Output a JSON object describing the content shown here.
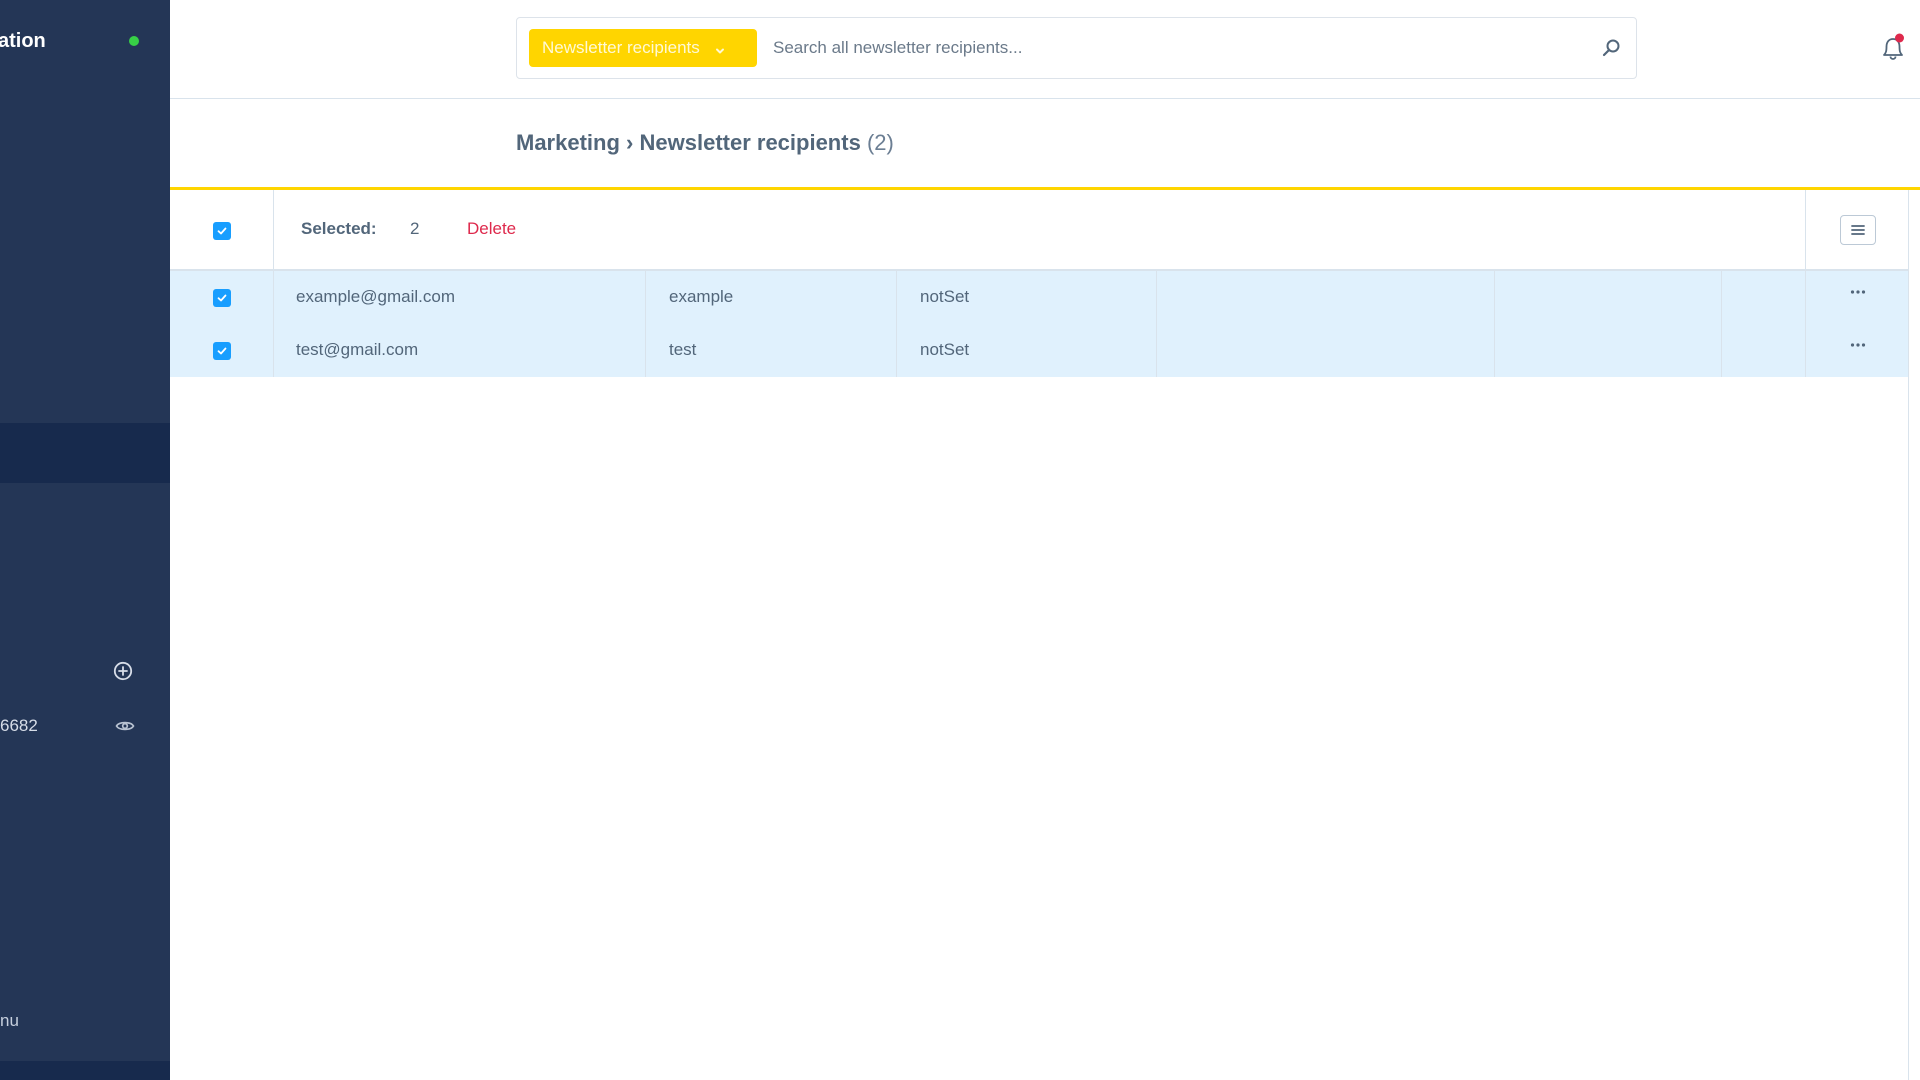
{
  "sidebar": {
    "title": "ation",
    "status_color": "#37d046",
    "account_id": "6682",
    "menu_label": "nu",
    "icons": [
      "plus-circle-icon",
      "eye-icon"
    ]
  },
  "header": {
    "entity_select": {
      "label": "Newsletter recipients",
      "icon": "chevron-down-icon"
    },
    "search": {
      "placeholder": "Search all newsletter recipients...",
      "value": "",
      "icon": "search-icon"
    },
    "notifications": {
      "icon": "bell-icon",
      "has_unread": true
    }
  },
  "breadcrumb": {
    "parent": "Marketing",
    "separator": "›",
    "current": "Newsletter recipients",
    "count": "(2)"
  },
  "colors": {
    "accent": "#ffd500",
    "sidebar_bg": "#243656",
    "checkbox": "#189eff",
    "danger": "#de294c",
    "row_selected_bg": "#e0f1fd"
  },
  "selection": {
    "label": "Selected:",
    "count": "2",
    "delete_label": "Delete",
    "all_checked": true
  },
  "table": {
    "rows": [
      {
        "checked": true,
        "email": "example@gmail.com",
        "name": "example",
        "status": "notSet",
        "col4": "",
        "col5": "",
        "col6": ""
      },
      {
        "checked": true,
        "email": "test@gmail.com",
        "name": "test",
        "status": "notSet",
        "col4": "",
        "col5": "",
        "col6": ""
      }
    ],
    "row_action_icon": "more-horizontal-icon",
    "settings_icon": "list-settings-icon"
  }
}
